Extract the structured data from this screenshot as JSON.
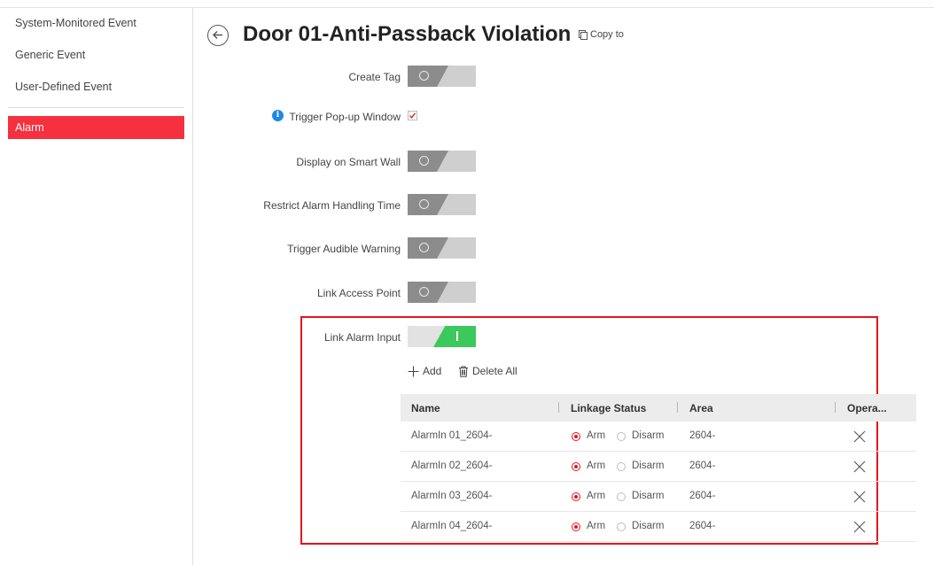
{
  "sidebar": {
    "items": [
      {
        "label": "System-Monitored Event"
      },
      {
        "label": "Generic Event"
      },
      {
        "label": "User-Defined Event"
      },
      {
        "label": "Alarm",
        "active": true
      }
    ]
  },
  "header": {
    "title": "Door 01-Anti-Passback Violation",
    "copy_to": "Copy to"
  },
  "form": {
    "create_tag": {
      "label": "Create Tag",
      "state": "off"
    },
    "trigger_popup": {
      "label": "Trigger Pop-up Window",
      "checked": true
    },
    "smart_wall": {
      "label": "Display on Smart Wall",
      "state": "off"
    },
    "restrict_time": {
      "label": "Restrict Alarm Handling Time",
      "state": "off"
    },
    "audible_warning": {
      "label": "Trigger Audible Warning",
      "state": "off"
    },
    "link_access_point": {
      "label": "Link Access Point",
      "state": "off"
    },
    "link_alarm_input": {
      "label": "Link Alarm Input",
      "state": "on"
    }
  },
  "actions": {
    "add": "Add",
    "delete_all": "Delete All"
  },
  "table": {
    "columns": {
      "name": "Name",
      "linkage_status": "Linkage Status",
      "area": "Area",
      "operation": "Opera..."
    },
    "arm_label": "Arm",
    "disarm_label": "Disarm",
    "rows": [
      {
        "name": "AlarmIn 01_2604-",
        "status": "Arm",
        "area": "2604-"
      },
      {
        "name": "AlarmIn 02_2604-",
        "status": "Arm",
        "area": "2604-"
      },
      {
        "name": "AlarmIn 03_2604-",
        "status": "Arm",
        "area": "2604-"
      },
      {
        "name": "AlarmIn 04_2604-",
        "status": "Arm",
        "area": "2604-"
      }
    ]
  },
  "colors": {
    "accent_red": "#f6303e",
    "toggle_on": "#3cc85a",
    "info_blue": "#1e88e5"
  }
}
